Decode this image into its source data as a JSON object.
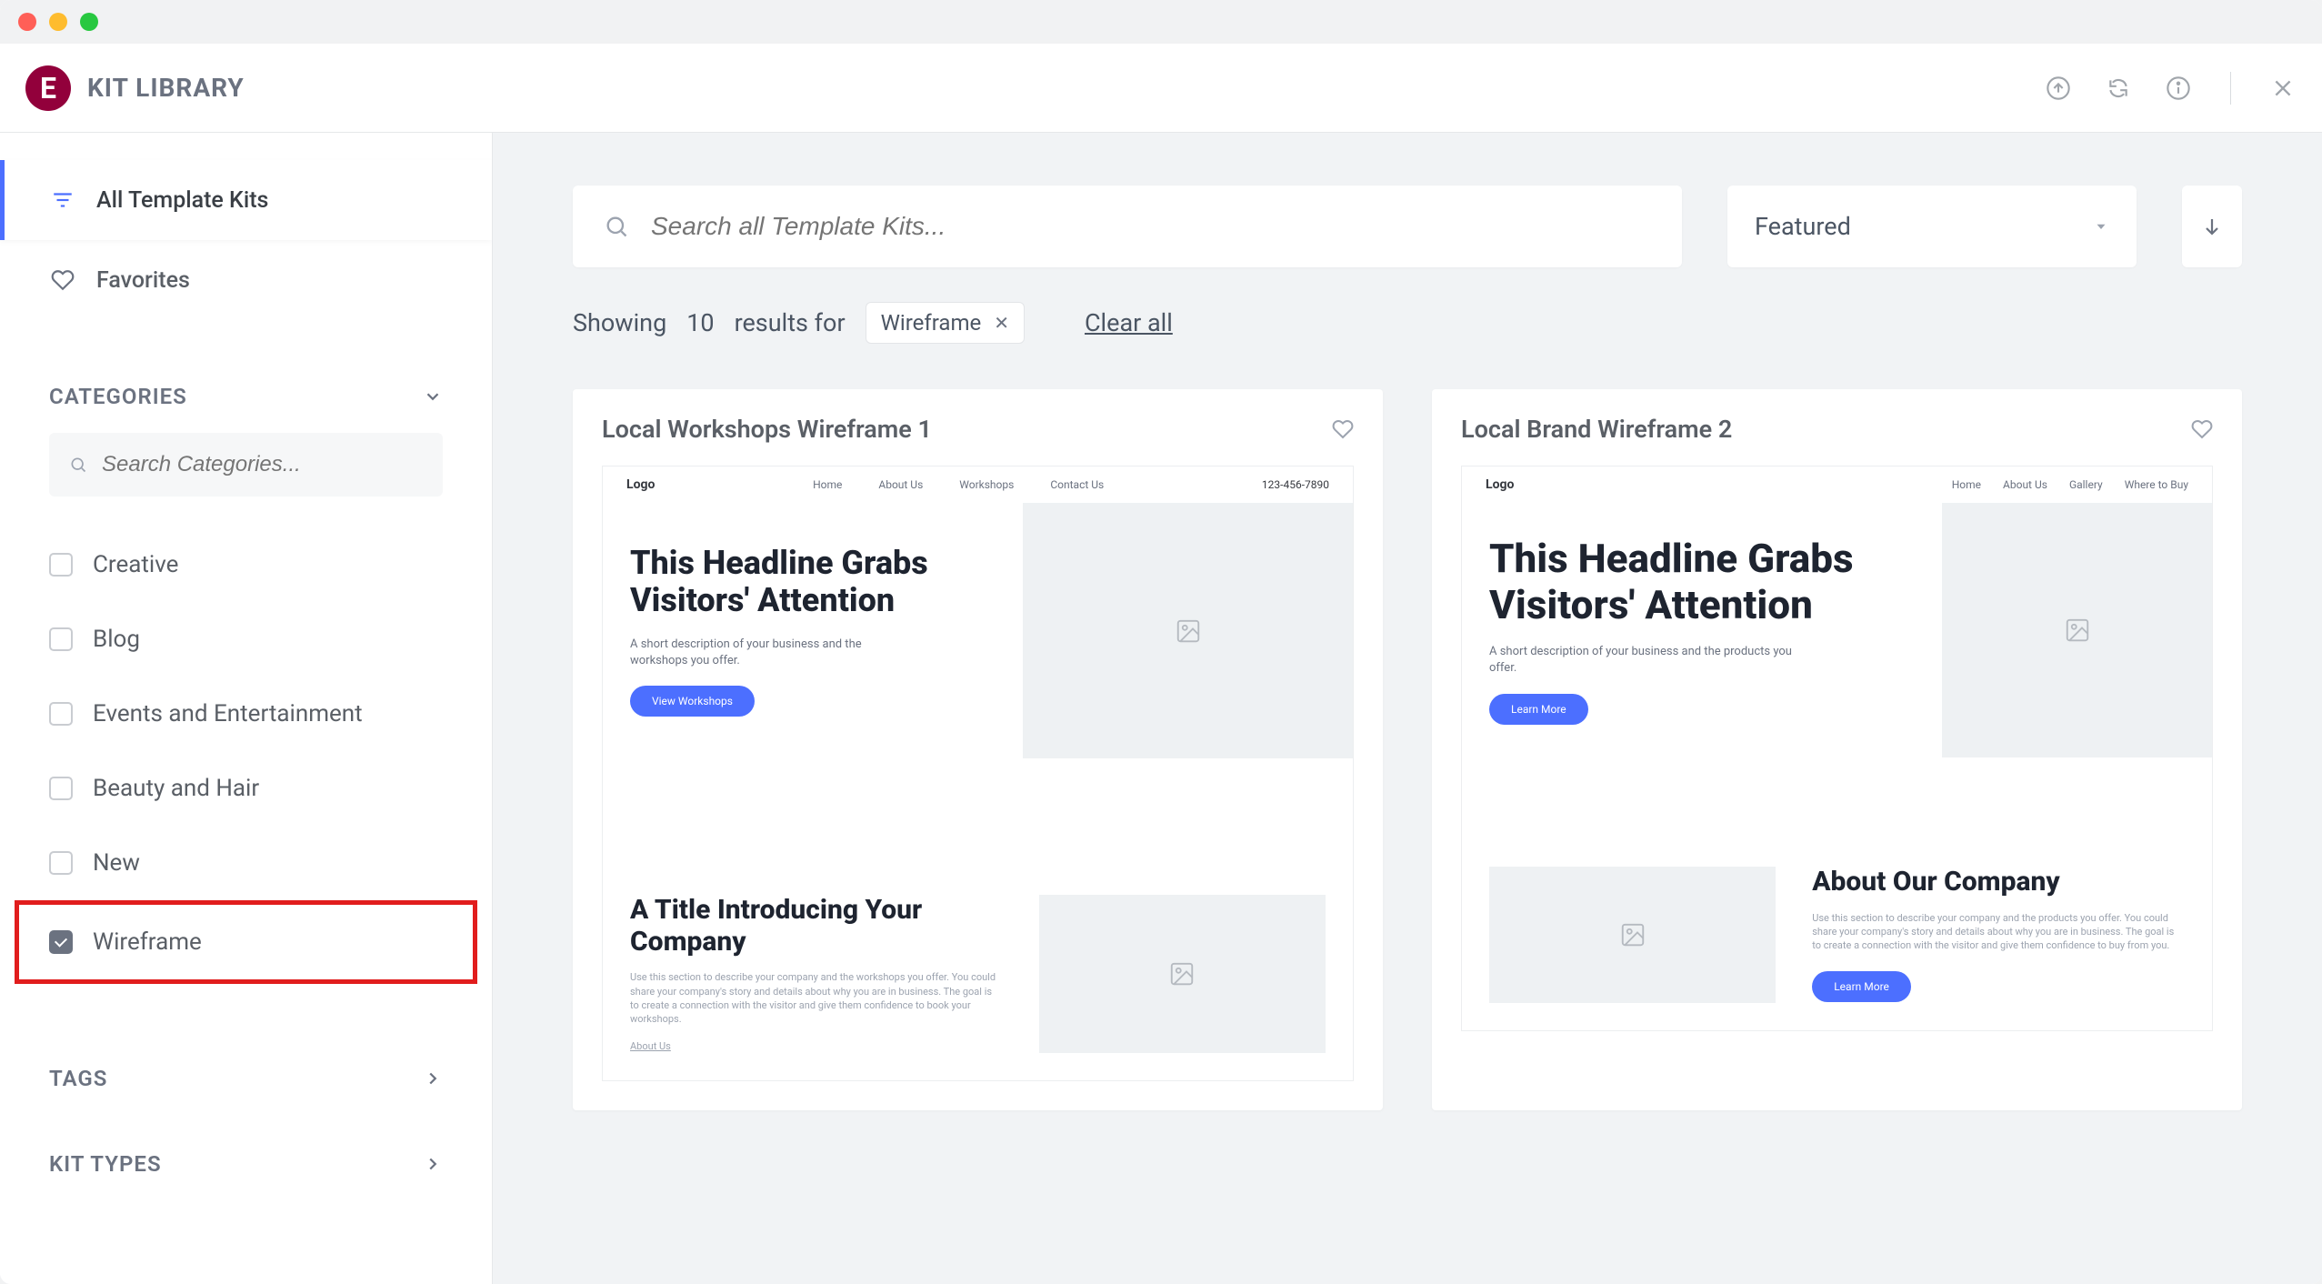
{
  "app_title": "KIT LIBRARY",
  "header_icons": [
    "upload",
    "refresh",
    "info",
    "close"
  ],
  "sidebar": {
    "nav": [
      {
        "label": "All Template Kits",
        "icon": "filter",
        "active": true
      },
      {
        "label": "Favorites",
        "icon": "heart",
        "active": false
      }
    ],
    "categories_label": "CATEGORIES",
    "search_cat_placeholder": "Search Categories...",
    "categories": [
      {
        "label": "Creative",
        "checked": false
      },
      {
        "label": "Blog",
        "checked": false
      },
      {
        "label": "Events and Entertainment",
        "checked": false
      },
      {
        "label": "Beauty and Hair",
        "checked": false
      },
      {
        "label": "New",
        "checked": false
      },
      {
        "label": "Wireframe",
        "checked": true,
        "highlight": true
      }
    ],
    "tags_label": "TAGS",
    "kit_types_label": "KIT TYPES"
  },
  "search_placeholder": "Search all Template Kits...",
  "sort": {
    "value": "Featured"
  },
  "results": {
    "prefix": "Showing",
    "count": "10",
    "mid": "results for",
    "chip": "Wireframe",
    "clear_all": "Clear all"
  },
  "cards": [
    {
      "title": "Local Workshops Wireframe 1",
      "wf": {
        "logo": "Logo",
        "nav": [
          "Home",
          "About Us",
          "Workshops",
          "Contact Us"
        ],
        "phone": "123-456-7890",
        "h1": "This Headline Grabs Visitors' Attention",
        "sub": "A short description of your business and the workshops you offer.",
        "btn": "View Workshops",
        "h2": "A Title Introducing Your Company",
        "p": "Use this section to describe your company and the workshops you offer. You could share your company's story and details about why you are in business. The goal is to create a connection with the visitor and give them confidence to book your workshops.",
        "link": "About Us"
      }
    },
    {
      "title": "Local Brand Wireframe 2",
      "wf": {
        "logo": "Logo",
        "nav": [
          "Home",
          "About Us",
          "Gallery",
          "Where to Buy"
        ],
        "phone": "",
        "h1": "This Headline Grabs Visitors' Attention",
        "sub": "A short description of your business and the products you offer.",
        "btn": "Learn More",
        "h2": "About Our Company",
        "p": "Use this section to describe your company and the products you offer. You could share your company's story and details about why you are in business. The goal is to create a connection with the visitor and give them confidence to buy from you.",
        "btn2": "Learn More"
      }
    }
  ]
}
